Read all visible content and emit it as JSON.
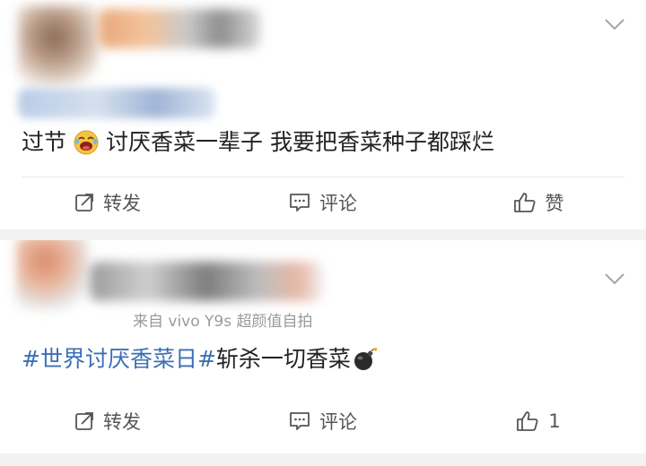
{
  "posts": [
    {
      "meta_visible": "",
      "text_pre": "过节",
      "text_post": "讨厌香菜一辈子 我要把香菜种子都踩烂",
      "emoji": "laughing-crying-face",
      "actions": {
        "repost_label": "转发",
        "comment_label": "评论",
        "like_label": "赞"
      }
    },
    {
      "meta_visible": "来自 vivo Y9s 超颜值自拍",
      "hashtag": "#世界讨厌香菜日#",
      "text": "斩杀一切香菜",
      "emoji": "bomb",
      "actions": {
        "repost_label": "转发",
        "comment_label": "评论",
        "like_label": "1"
      }
    }
  ],
  "colors": {
    "background": "#f2f2f2",
    "card": "#ffffff",
    "hashtag": "#3b6fb5",
    "text": "#222222",
    "muted": "#9a9a9a"
  },
  "icons": [
    "chevron-down-icon",
    "repost-icon",
    "comment-icon",
    "like-icon",
    "laughing-emoji-icon",
    "bomb-emoji-icon"
  ]
}
